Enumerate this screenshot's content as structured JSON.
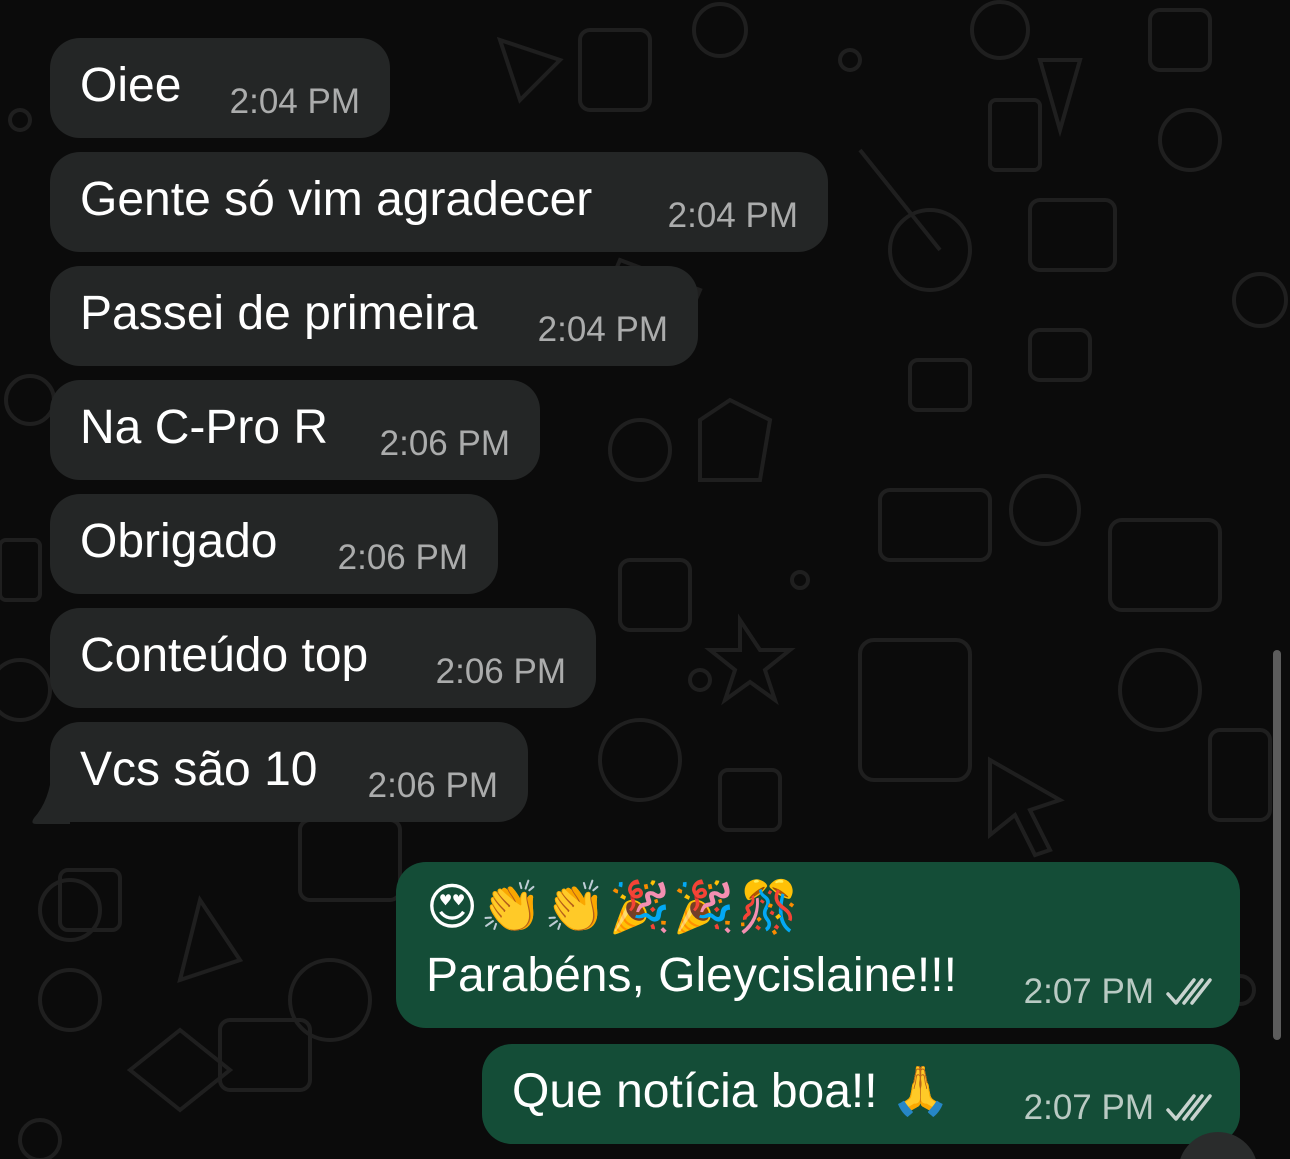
{
  "chat": {
    "incoming": [
      {
        "text": "Oiee",
        "time": "2:04 PM"
      },
      {
        "text": "Gente só vim agradecer",
        "time": "2:04 PM"
      },
      {
        "text": "Passei de primeira",
        "time": "2:04 PM"
      },
      {
        "text": "Na C-Pro R",
        "time": "2:06 PM"
      },
      {
        "text": "Obrigado",
        "time": "2:06 PM"
      },
      {
        "text": "Conteúdo top",
        "time": "2:06 PM"
      },
      {
        "text": "Vcs são 10",
        "time": "2:06 PM"
      }
    ],
    "outgoing": [
      {
        "emojis": "😍👏👏🎉🎉🎊",
        "text": "Parabéns, Gleycislaine!!!",
        "time": "2:07 PM",
        "status": "read-double-check-icon"
      },
      {
        "text": "Que notícia boa!! 🙏",
        "time": "2:07 PM",
        "status": "read-double-check-icon"
      }
    ]
  },
  "colors": {
    "background": "#0b0b0b",
    "incoming_bubble": "#242626",
    "outgoing_bubble": "#144d37",
    "timestamp": "#9e9e9e"
  }
}
